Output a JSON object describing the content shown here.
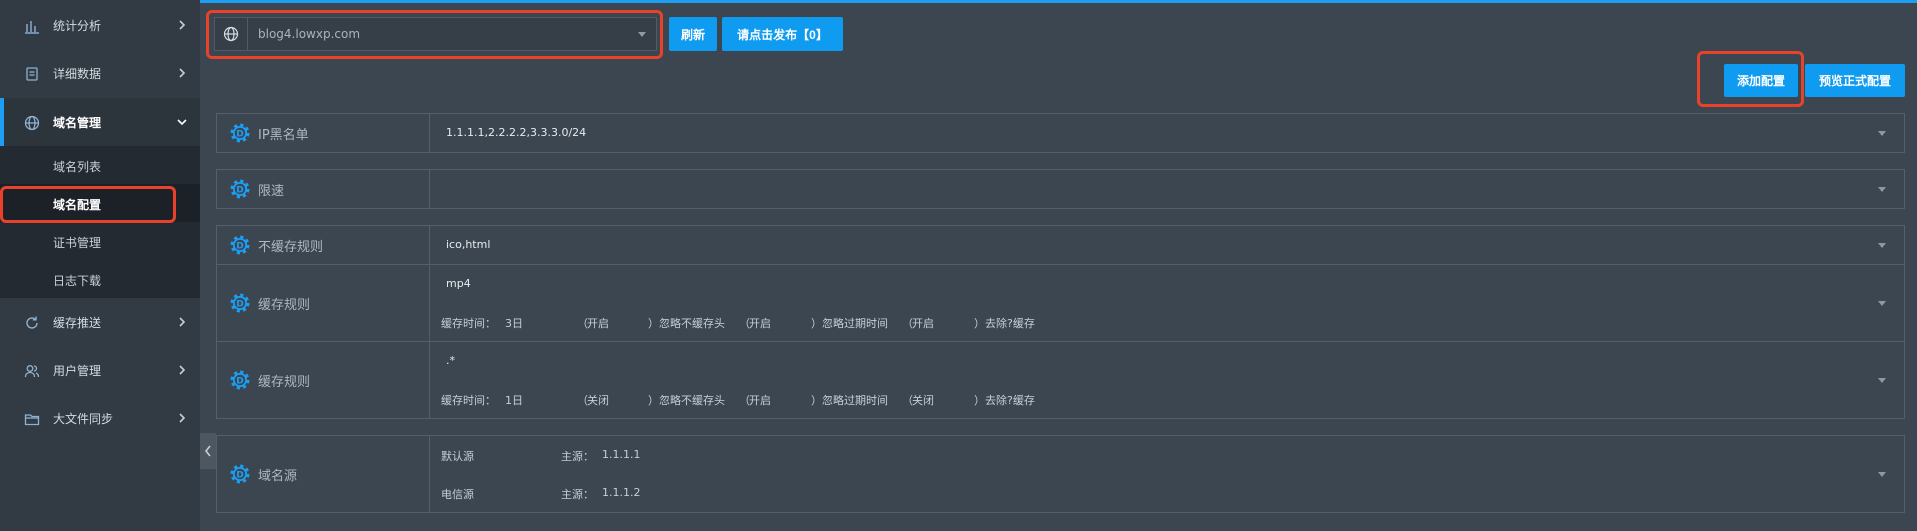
{
  "sidebar": {
    "items": [
      {
        "label": "统计分析",
        "icon": "bar-chart-icon"
      },
      {
        "label": "详细数据",
        "icon": "document-icon"
      },
      {
        "label": "域名管理",
        "icon": "globe-icon"
      },
      {
        "label": "缓存推送",
        "icon": "refresh-icon"
      },
      {
        "label": "用户管理",
        "icon": "users-icon"
      },
      {
        "label": "大文件同步",
        "icon": "folder-icon"
      }
    ],
    "subitems": [
      "域名列表",
      "域名配置",
      "证书管理",
      "日志下载"
    ]
  },
  "topbar": {
    "domain": "blog4.lowxp.com",
    "refresh_label": "刷新",
    "publish_label": "请点击发布【0】"
  },
  "actions": {
    "add_label": "添加配置",
    "preview_label": "预览正式配置"
  },
  "rows": {
    "ip_blacklist": {
      "label": "IP黑名单",
      "value": "1.1.1.1,2.2.2.2,3.3.3.0/24"
    },
    "rate_limit": {
      "label": "限速",
      "value": ""
    },
    "no_cache": {
      "label": "不缓存规则",
      "value": "ico,html"
    },
    "cache1": {
      "label": "缓存规则",
      "value": "mp4",
      "time_label": "缓存时间：",
      "time": "3日",
      "open1": "（",
      "ignore_nocache_val": "开启",
      "ignore_nocache_txt": "）忽略不缓存头",
      "open2": "（",
      "ignore_expire_val": "开启",
      "ignore_expire_txt": "）忽略过期时间",
      "open3": "（",
      "remove_val": "开启",
      "remove_txt": "）去除?缓存"
    },
    "cache2": {
      "label": "缓存规则",
      "value": ".*",
      "time_label": "缓存时间：",
      "time": "1日",
      "open1": "（",
      "ignore_nocache_val": "关闭",
      "ignore_nocache_txt": "）忽略不缓存头",
      "open2": "（",
      "ignore_expire_val": "开启",
      "ignore_expire_txt": "）忽略过期时间",
      "open3": "（",
      "remove_val": "关闭",
      "remove_txt": "）去除?缓存"
    },
    "origin": {
      "label": "域名源",
      "default_label": "默认源",
      "default_main": "主源：",
      "default_ip": "1.1.1.1",
      "telecom_label": "电信源",
      "telecom_main": "主源：",
      "telecom_ip": "1.1.1.2"
    }
  },
  "colors": {
    "accent": "#1c9ef2",
    "highlight": "#e8432a",
    "sidebar": "#323a43"
  }
}
